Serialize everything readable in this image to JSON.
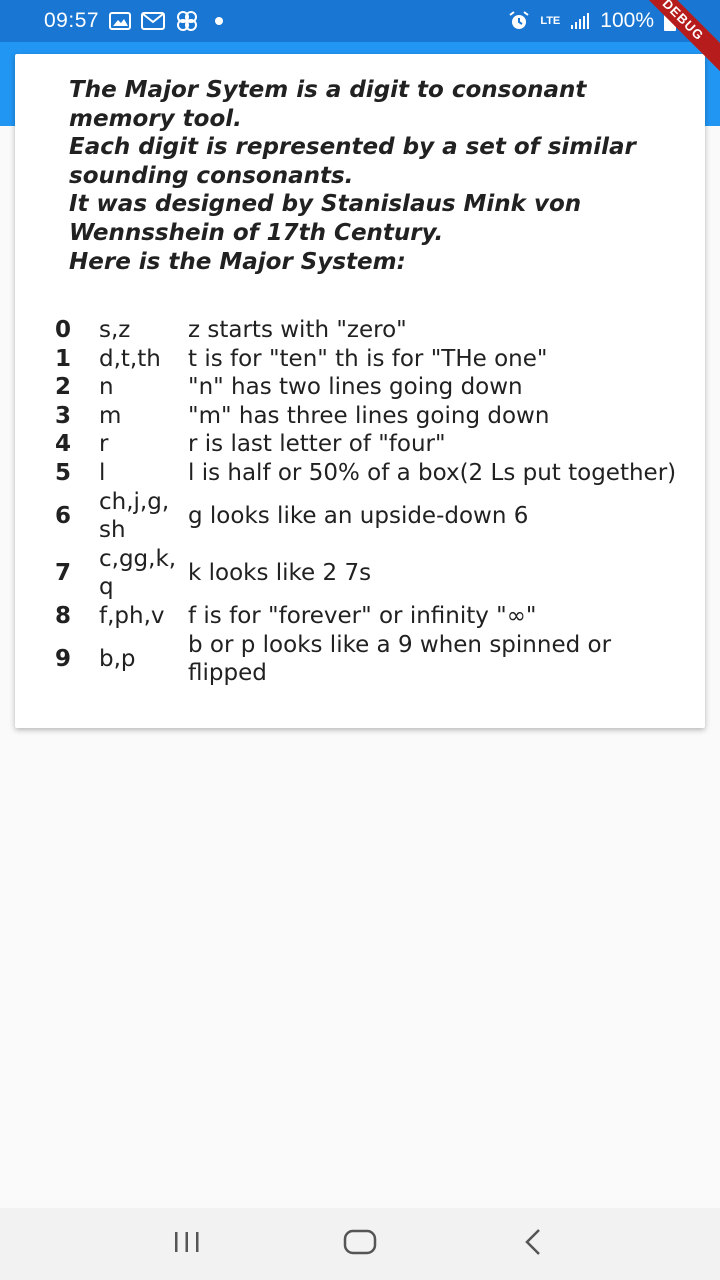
{
  "status_bar": {
    "time": "09:57",
    "network": "LTE",
    "battery": "100%",
    "icons": [
      "gallery-icon",
      "gmail-icon",
      "pinwheel-icon",
      "notification-dot-icon",
      "alarm-icon",
      "lte-icon",
      "signal-icon",
      "battery-icon"
    ]
  },
  "debug_banner": "DEBUG",
  "intro": {
    "line1": "The Major Sytem is a digit to consonant memory tool.",
    "line2": "Each digit is represented by a set of similar sounding consonants.",
    "line3": "It was designed by Stanislaus Mink von Wennsshein of 17th Century.",
    "line4": "Here is the Major System:"
  },
  "major_system": [
    {
      "digit": "0",
      "consonants": "s,z",
      "mnemonic": "z starts with \"zero\""
    },
    {
      "digit": "1",
      "consonants": "d,t,th",
      "mnemonic": "t is for \"ten\" th is for \"THe one\""
    },
    {
      "digit": "2",
      "consonants": "n",
      "mnemonic": "\"n\" has two lines going down"
    },
    {
      "digit": "3",
      "consonants": "m",
      "mnemonic": "\"m\" has three lines going down"
    },
    {
      "digit": "4",
      "consonants": "r",
      "mnemonic": "r is last letter of \"four\""
    },
    {
      "digit": "5",
      "consonants": "l",
      "mnemonic": "l is half or 50% of a box(2 Ls put together)"
    },
    {
      "digit": "6",
      "consonants": "ch,j,g, sh",
      "mnemonic": "g looks like an upside-down 6"
    },
    {
      "digit": "7",
      "consonants": "c,gg,k, q",
      "mnemonic": "k looks like 2 7s"
    },
    {
      "digit": "8",
      "consonants": "f,ph,v",
      "mnemonic": "f is for \"forever\" or infinity \"∞\""
    },
    {
      "digit": "9",
      "consonants": "b,p",
      "mnemonic": "b or p looks like a 9 when spinned or flipped"
    }
  ],
  "colors": {
    "status_bar": "#1976d2",
    "app_bar": "#2196f3",
    "debug_banner": "#b71c1c",
    "background": "#fafafa",
    "card": "#ffffff"
  },
  "nav": {
    "icons": [
      "recent-apps-icon",
      "home-icon",
      "back-icon"
    ]
  }
}
